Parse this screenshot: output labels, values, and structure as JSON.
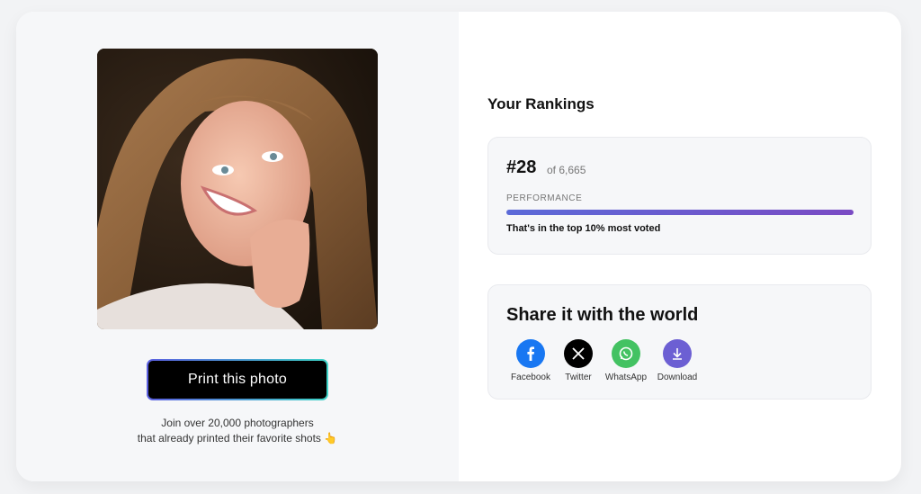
{
  "photo": {
    "alt": "Portrait of smiling girl with long hair"
  },
  "print_button": {
    "label": "Print this photo"
  },
  "join_text": {
    "line1": "Join over 20,000 photographers",
    "line2": "that already printed their favorite shots 👆"
  },
  "rankings": {
    "title": "Your Rankings",
    "rank": "#28",
    "of_total": "of 6,665",
    "performance_label": "PERFORMANCE",
    "performance_fraction": 1.0,
    "summary": "That's in the top 10% most voted"
  },
  "share": {
    "title": "Share it with the world",
    "items": [
      {
        "label": "Facebook",
        "icon": "facebook-icon",
        "color": "#1877f2"
      },
      {
        "label": "Twitter",
        "icon": "x-twitter-icon",
        "color": "#000000"
      },
      {
        "label": "WhatsApp",
        "icon": "whatsapp-icon",
        "color": "#43c262"
      },
      {
        "label": "Download",
        "icon": "download-icon",
        "color": "#6c5fd3"
      }
    ]
  },
  "colors": {
    "accent_gradient_start": "#5b6ad8",
    "accent_gradient_end": "#7a4bc4",
    "button_border_start": "#5b5fe0",
    "button_border_end": "#3fd3c7"
  }
}
